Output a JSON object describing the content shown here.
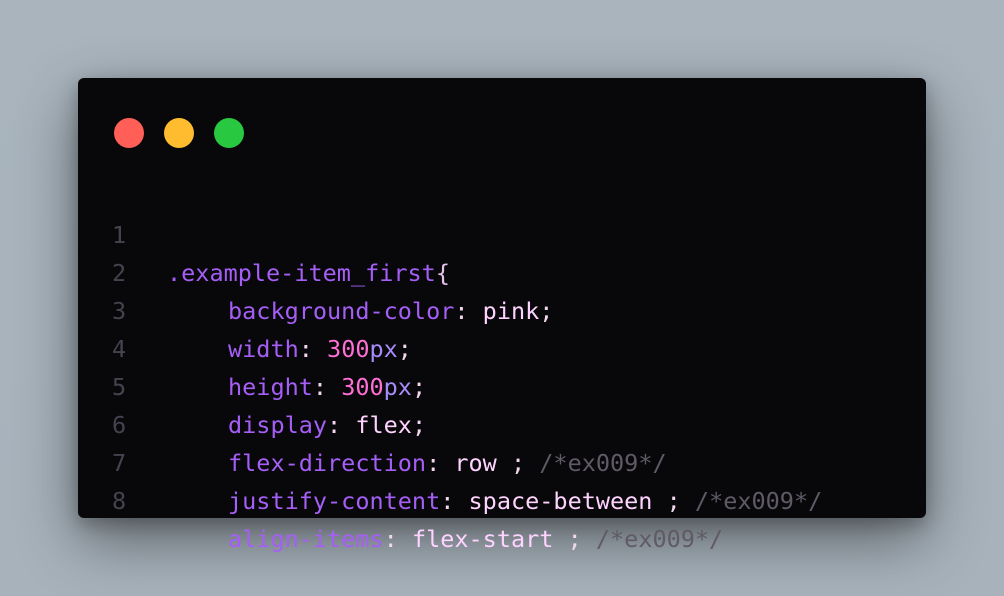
{
  "window": {
    "controls": {
      "close_color": "#ff5f57",
      "minimize_color": "#febc2e",
      "maximize_color": "#28c840"
    }
  },
  "code": {
    "line_numbers": [
      "1",
      "2",
      "3",
      "4",
      "5",
      "6",
      "7",
      "8"
    ],
    "selector": ".example-item_first",
    "open_brace": "{",
    "lines": [
      {
        "prop": "background-color",
        "value": "pink",
        "num": "",
        "unit": "",
        "end": ";",
        "comment": ""
      },
      {
        "prop": "width",
        "value": "",
        "num": "300",
        "unit": "px",
        "end": ";",
        "comment": ""
      },
      {
        "prop": "height",
        "value": "",
        "num": "300",
        "unit": "px",
        "end": ";",
        "comment": ""
      },
      {
        "prop": "display",
        "value": "flex",
        "num": "",
        "unit": "",
        "end": ";",
        "comment": ""
      },
      {
        "prop": "flex-direction",
        "value": "row",
        "num": "",
        "unit": "",
        "end": " ;",
        "comment": "/*ex009*/"
      },
      {
        "prop": "justify-content",
        "value": "space-between",
        "num": "",
        "unit": "",
        "end": " ;",
        "comment": "/*ex009*/"
      },
      {
        "prop": "align-items",
        "value": "flex-start",
        "num": "",
        "unit": "",
        "end": " ;",
        "comment": "/*ex009*/"
      }
    ],
    "colon": ": "
  }
}
